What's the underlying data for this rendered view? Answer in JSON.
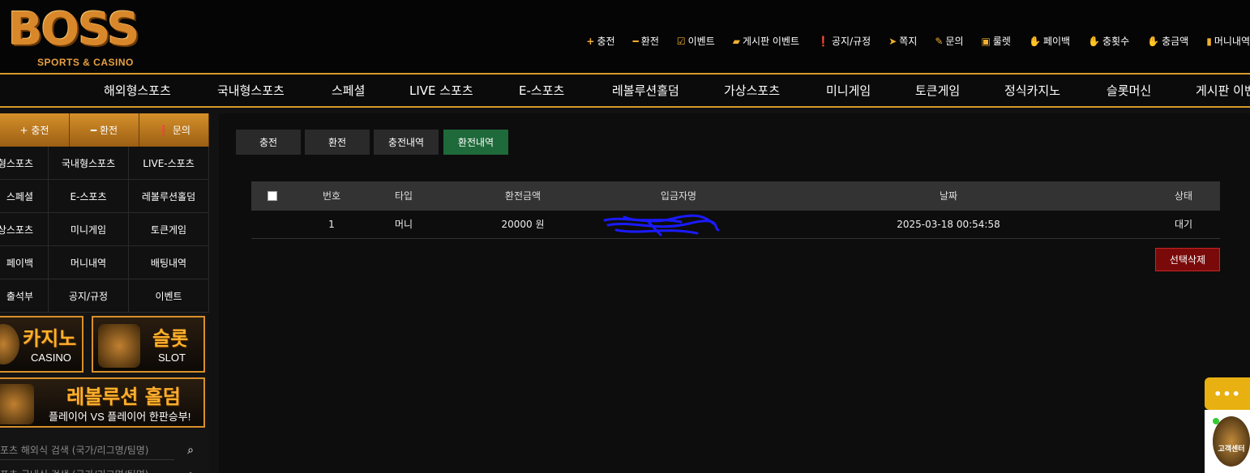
{
  "logo": {
    "main": "BOSS",
    "sub": "SPORTS & CASINO"
  },
  "top_links": [
    {
      "icon": "plus-icon",
      "glyph": "+",
      "label": "충전"
    },
    {
      "icon": "minus-icon",
      "glyph": "━",
      "label": "환전"
    },
    {
      "icon": "calendar-check-icon",
      "glyph": "☑",
      "label": "이벤트"
    },
    {
      "icon": "board-event-icon",
      "glyph": "▰",
      "label": "게시판 이벤트"
    },
    {
      "icon": "alert-icon",
      "glyph": "❗",
      "label": "공지/규정"
    },
    {
      "icon": "paper-plane-icon",
      "glyph": "➤",
      "label": "쪽지"
    },
    {
      "icon": "edit-icon",
      "glyph": "✎",
      "label": "문의"
    },
    {
      "icon": "gift-icon",
      "glyph": "▣",
      "label": "룰렛"
    },
    {
      "icon": "hand-coin-icon",
      "glyph": "✋",
      "label": "페이백"
    },
    {
      "icon": "hand-coin-icon",
      "glyph": "✋",
      "label": "충횟수"
    },
    {
      "icon": "hand-coin-icon",
      "glyph": "✋",
      "label": "충금액"
    },
    {
      "icon": "wallet-icon",
      "glyph": "▮",
      "label": "머니내역"
    }
  ],
  "main_nav": [
    "해외형스포츠",
    "국내형스포츠",
    "스페셜",
    "LIVE 스포츠",
    "E-스포츠",
    "레볼루션홀덤",
    "가상스포츠",
    "미니게임",
    "토큰게임",
    "정식카지노",
    "슬롯머신",
    "게시판 이벤"
  ],
  "sidebar": {
    "top_buttons": [
      {
        "glyph": "+",
        "label": "충전"
      },
      {
        "glyph": "━",
        "label": "환전"
      },
      {
        "glyph": "❗",
        "label": "문의"
      }
    ],
    "grid": [
      [
        "형스포츠",
        "국내형스포츠",
        "LIVE-스포츠"
      ],
      [
        "스페셜",
        "E-스포츠",
        "레볼루션홀덤"
      ],
      [
        "상스포츠",
        "미니게임",
        "토큰게임"
      ],
      [
        "페이백",
        "머니내역",
        "배팅내역"
      ],
      [
        "출석부",
        "공지/규정",
        "이벤트"
      ]
    ],
    "banners": {
      "casino": {
        "title": "카지노",
        "sub": "CASINO"
      },
      "slot": {
        "title": "슬롯",
        "sub": "SLOT"
      },
      "holdem": {
        "title": "레볼루션 홀덤",
        "sub": "플레이어 VS 플레이어 한판승부!"
      }
    },
    "search": [
      {
        "placeholder": "포츠 해외식 검색 (국가/리그명/팀명)"
      },
      {
        "placeholder": "포츠 국내식 검색 (국가/리그명/팀명)"
      }
    ]
  },
  "tabs": [
    {
      "label": "충전",
      "active": false
    },
    {
      "label": "환전",
      "active": false
    },
    {
      "label": "충전내역",
      "active": false
    },
    {
      "label": "환전내역",
      "active": true
    }
  ],
  "table": {
    "headers": [
      "번호",
      "타입",
      "환전금액",
      "입금자명",
      "날짜",
      "상태"
    ],
    "rows": [
      {
        "no": "1",
        "type": "머니",
        "amount": "20000 원",
        "name": "",
        "date": "2025-03-18 00:54:58",
        "status": "대기"
      }
    ]
  },
  "delete_button": "선택삭제",
  "chat": {
    "more": "•••",
    "label": "고객센터"
  },
  "colors": {
    "accent": "#d89a2a",
    "active_tab": "#1e6a3a",
    "delete": "#7a0a0a",
    "chat": "#e8b010"
  }
}
